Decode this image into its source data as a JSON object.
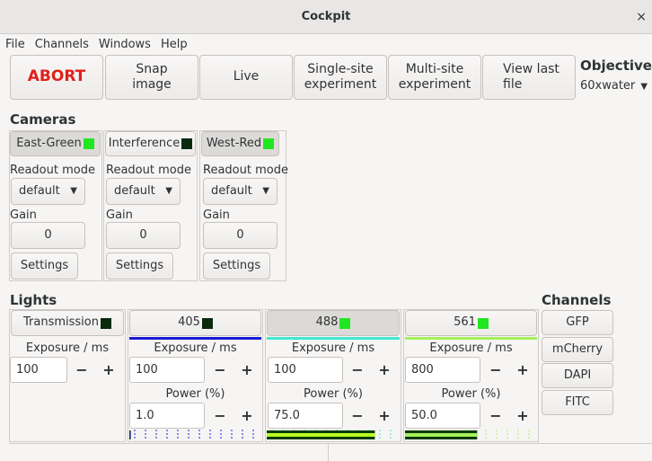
{
  "window": {
    "title": "Cockpit",
    "close_glyph": "×"
  },
  "menu": [
    "File",
    "Channels",
    "Windows",
    "Help"
  ],
  "toolbar": {
    "abort": "ABORT",
    "snap": "Snap\nimage",
    "live": "Live",
    "single": "Single-site\nexperiment",
    "multi": "Multi-site\nexperiment",
    "viewlast": "View last\nfile"
  },
  "objective": {
    "title": "Objective",
    "value": "60xwater"
  },
  "cameras": {
    "title": "Cameras",
    "items": [
      {
        "name": "East-Green",
        "swatch": "#22e622",
        "readout_label": "Readout mode",
        "readout_value": "default",
        "gain_label": "Gain",
        "gain_value": "0",
        "settings": "Settings"
      },
      {
        "name": "Interference",
        "swatch": "#0a2a10",
        "readout_label": "Readout mode",
        "readout_value": "default",
        "gain_label": "Gain",
        "gain_value": "0",
        "settings": "Settings"
      },
      {
        "name": "West-Red",
        "swatch": "#22e622",
        "readout_label": "Readout mode",
        "readout_value": "default",
        "gain_label": "Gain",
        "gain_value": "0",
        "settings": "Settings"
      }
    ]
  },
  "lights": {
    "title": "Lights",
    "items": [
      {
        "name": "Transmission",
        "swatch": "#0a2a10",
        "exposure_label": "Exposure / ms",
        "exposure": "100",
        "bar_color": ""
      },
      {
        "name": "405",
        "swatch": "#0a2a10",
        "exposure_label": "Exposure / ms",
        "exposure": "100",
        "power_label": "Power (%)",
        "power": "1.0",
        "bar_color": "#1a1ad4",
        "level": 0.01
      },
      {
        "name": "488",
        "swatch": "#22e622",
        "exposure_label": "Exposure / ms",
        "exposure": "100",
        "power_label": "Power (%)",
        "power": "75.0",
        "bar_color": "#3fe8d0",
        "level": 0.75
      },
      {
        "name": "561",
        "swatch": "#22e622",
        "exposure_label": "Exposure / ms",
        "exposure": "800",
        "power_label": "Power (%)",
        "power": "50.0",
        "bar_color": "#a6f05a",
        "level": 0.5
      }
    ],
    "minus": "−",
    "plus": "+"
  },
  "channels": {
    "title": "Channels",
    "items": [
      "GFP",
      "mCherry",
      "DAPI",
      "FITC"
    ]
  }
}
